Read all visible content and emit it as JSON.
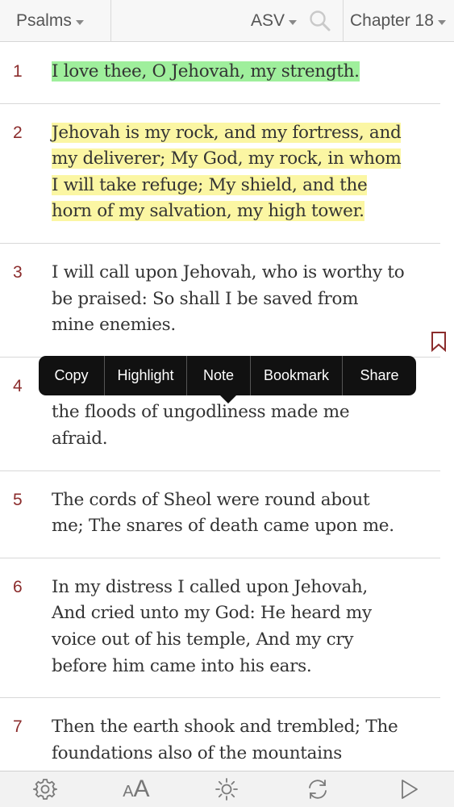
{
  "topbar": {
    "book": "Psalms",
    "translation": "ASV",
    "chapter": "Chapter 18"
  },
  "verses": [
    {
      "num": "1",
      "text": "I love thee, O Jehovah, my strength.",
      "highlight": "green"
    },
    {
      "num": "2",
      "text": "Jehovah is my rock, and my fortress, and my deliverer; My God, my rock, in whom I will take refuge; My shield, and the horn of my salvation, my high tower.",
      "highlight": "yellow"
    },
    {
      "num": "3",
      "text": "I will call upon Jehovah, who is worthy to be praised: So shall I be saved from mine enemies.",
      "highlight": "none",
      "bookmarked": true
    },
    {
      "num": "4",
      "text": "The cords of death compassed me, And the floods of ungodliness made me afraid.",
      "highlight": "none"
    },
    {
      "num": "5",
      "text": "The cords of Sheol were round about me; The snares of death came upon me.",
      "highlight": "none"
    },
    {
      "num": "6",
      "text": "In my distress I called upon Jehovah, And cried unto my God: He heard my voice out of his temple, And my cry before him came into his ears.",
      "highlight": "none"
    },
    {
      "num": "7",
      "text": "Then the earth shook and trembled; The foundations also of the mountains quaked And were shaken, because he",
      "highlight": "none"
    }
  ],
  "popup": {
    "copy": "Copy",
    "highlight": "Highlight",
    "note": "Note",
    "bookmark": "Bookmark",
    "share": "Share"
  },
  "bottombar": {
    "font_size_label": "AA",
    "icons": [
      "gear-icon",
      "font-size-icon",
      "brightness-icon",
      "refresh-icon",
      "play-icon"
    ]
  },
  "colors": {
    "verse_number": "#8b2c2c",
    "highlight_green": "#9fef9c",
    "highlight_yellow": "#fbf6a3",
    "popup_bg": "#111111"
  }
}
